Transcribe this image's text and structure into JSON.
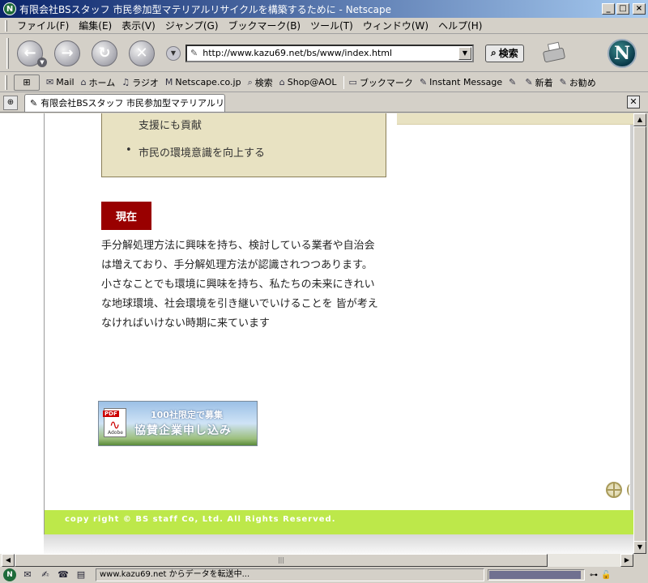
{
  "window": {
    "title": "有限会社BSスタッフ 市民参加型マテリアルリサイクルを構築するために - Netscape",
    "app_icon_letter": "N"
  },
  "menu": [
    "ファイル(F)",
    "編集(E)",
    "表示(V)",
    "ジャンプ(G)",
    "ブックマーク(B)",
    "ツール(T)",
    "ウィンドウ(W)",
    "ヘルプ(H)"
  ],
  "navbar": {
    "url": "http://www.kazu69.net/bs/www/index.html",
    "search_label": "検索"
  },
  "personal_toolbar": [
    {
      "icon": "mail-icon",
      "glyph": "✉",
      "label": "Mail"
    },
    {
      "icon": "home-icon",
      "glyph": "⌂",
      "label": "ホーム"
    },
    {
      "icon": "radio-icon",
      "glyph": "♫",
      "label": "ラジオ"
    },
    {
      "icon": "netscape-site-icon",
      "glyph": "M",
      "label": "Netscape.co.jp"
    },
    {
      "icon": "search-icon",
      "glyph": "⌕",
      "label": "検索"
    },
    {
      "icon": "shop-icon",
      "glyph": "⌂",
      "label": "Shop@AOL"
    },
    {
      "icon": "bookmark-folder-icon",
      "glyph": "▭",
      "label": "ブックマーク"
    },
    {
      "icon": "instant-message-icon",
      "glyph": "✎",
      "label": "Instant Message"
    },
    {
      "icon": "link-icon",
      "glyph": "✎",
      "label": ""
    },
    {
      "icon": "link-icon",
      "glyph": "✎",
      "label": "新着"
    },
    {
      "icon": "link-icon",
      "glyph": "✎",
      "label": "お勧め"
    }
  ],
  "tab": {
    "label": "有限会社BSスタッフ 市民参加型マテリアルリ..."
  },
  "page": {
    "box_line1": "支援にも貢献",
    "box_bullet": "市民の環境意識を向上する",
    "badge": "現在",
    "body": "手分解処理方法に興味を持ち、検討している業者や自治会は増えており、手分解処理方法が認識されつつあります。小さなことでも環境に興味を持ち、私たちの未来にきれいな地球環境、社会環境を引き継いでいけることを 皆が考えなければいけない時期に来ています",
    "banner_line1": "100社限定で募集",
    "banner_line2": "協賛企業申し込み",
    "banner_pdf_tag": "PDF",
    "banner_adobe": "Adobe",
    "footer": "copy right © BS staff Co, Ltd. All Rights Reserved."
  },
  "status": {
    "text": "www.kazu69.net からデータを転送中...",
    "progress": 0.97
  },
  "colors": {
    "badge": "#990000",
    "footer": "#bde84a",
    "box_bg": "#e8e2c2"
  }
}
